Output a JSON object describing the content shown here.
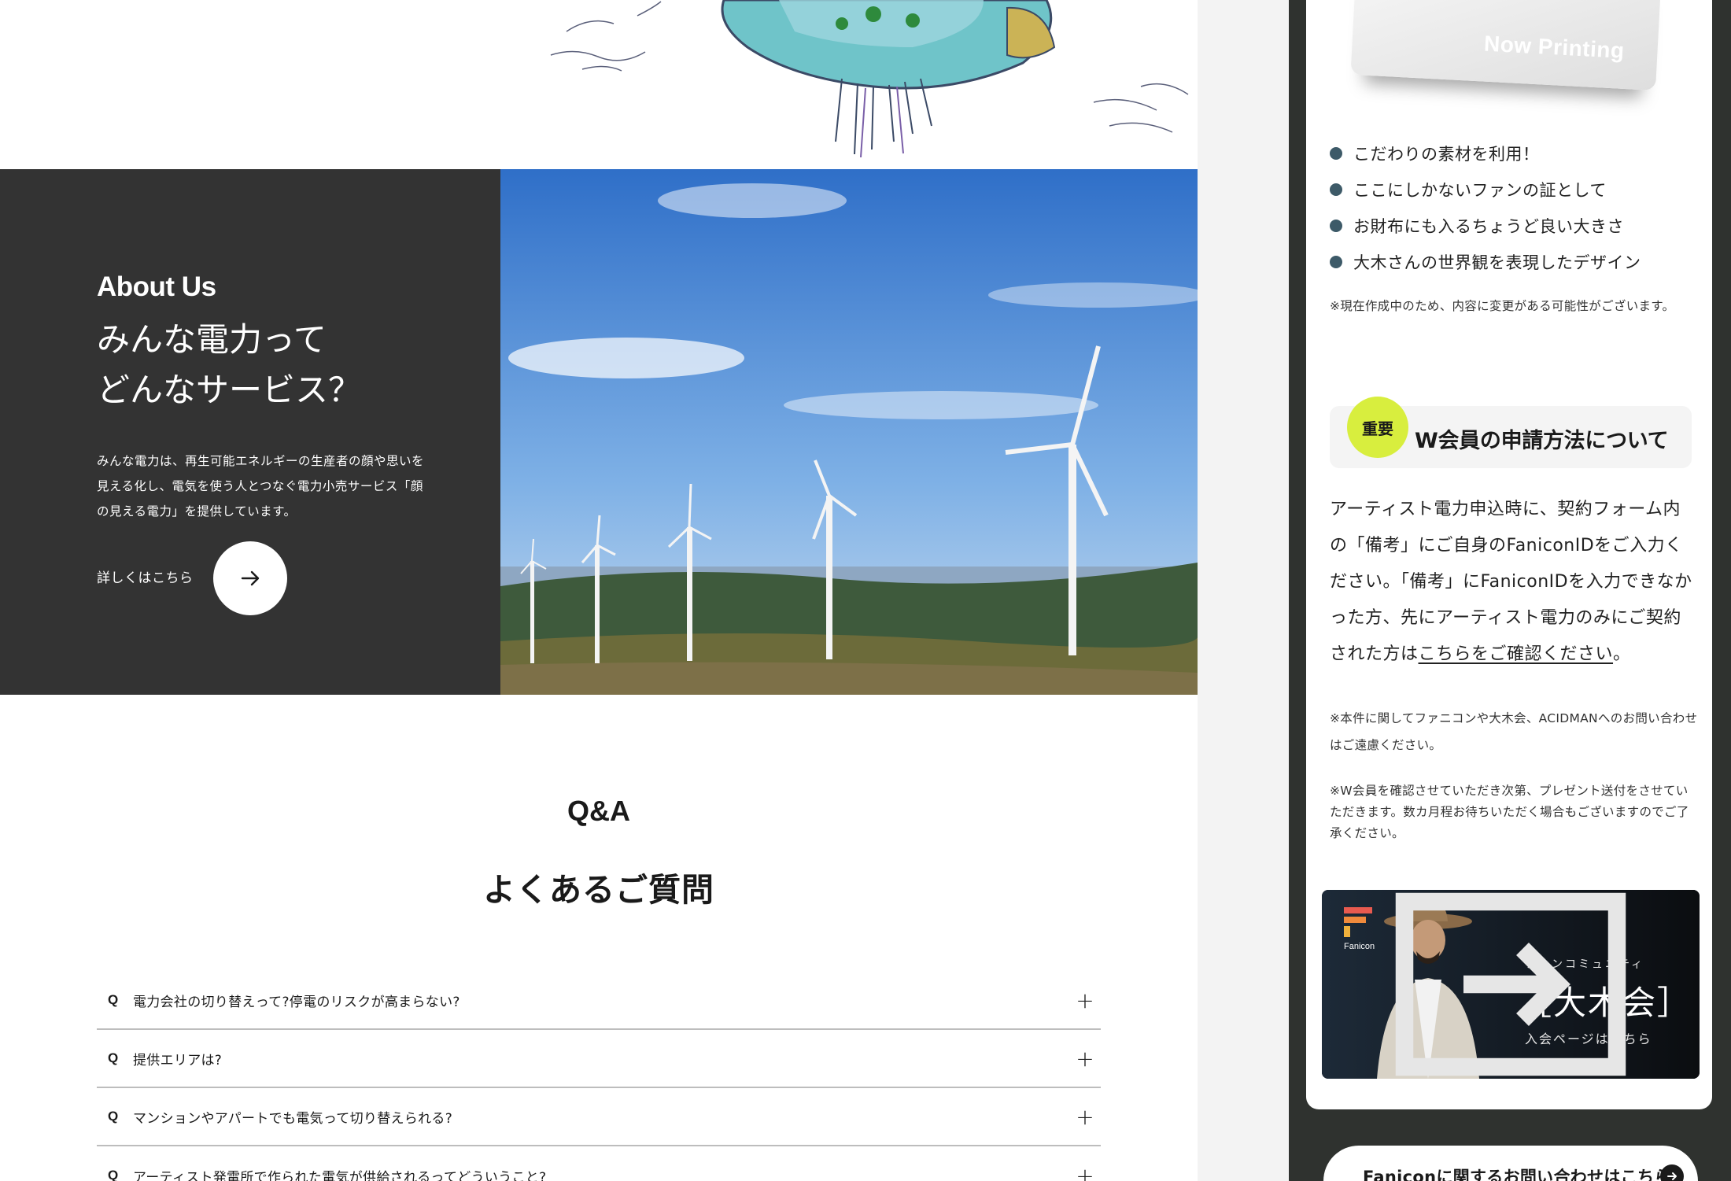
{
  "about": {
    "en_label": "About Us",
    "title_line1": "みんな電力って",
    "title_line2": "どんなサービス？",
    "description": "みんな電力は、再生可能エネルギーの生産者の顔や思いを見える化し、電気を使う人とつなぐ電力小売サービス「顔の見える電力」を提供しています。",
    "more_label": "詳しくはこちら"
  },
  "qa": {
    "en_label": "Q&A",
    "title": "よくあるご質問",
    "items": [
      {
        "q": "Q",
        "text": "電力会社の切り替えって?停電のリスクが高まらない?"
      },
      {
        "q": "Q",
        "text": "提供エリアは?"
      },
      {
        "q": "Q",
        "text": "マンションやアパートでも電気って切り替えられる?"
      },
      {
        "q": "Q",
        "text": "アーティスト発電所で作られた電気が供給されるってどういうこと?"
      }
    ],
    "expand_symbol": "+"
  },
  "sidebar": {
    "card_placeholder": "Now Printing",
    "features": [
      "こだわりの素材を利用！",
      "ここにしかないファンの証として",
      "お財布にも入るちょうど良い大きさ",
      "大木さんの世界観を表現したデザイン"
    ],
    "note_in_progress": "※現在作成中のため、内容に変更がある可能性がございます。",
    "important_badge": "重要",
    "important_title": "W会員の申請方法について",
    "apply_text": "アーティスト電力申込時に、契約フォーム内の「備考」にご自身のFaniconIDをご入力ください。「備考」にFaniconIDを入力できなかった方、先にアーティスト電力のみにご契約された方は",
    "apply_link": "こちらをご確認ください",
    "apply_end": "。",
    "note_inquiry": "※本件に関してファニコンや大木会、ACIDMANへのお問い合わせはご遠慮ください。",
    "note_present": "※W会員を確認させていただき次第、プレゼント送付をさせていただきます。数カ月程お待ちいただく場合もございますのでご了承ください。",
    "banner": {
      "brand": "Fanicon",
      "subtitle": "ファンコミュニティ",
      "name": "［大木会］",
      "join_label": "入会ページはこちら"
    },
    "contact_label": "Faniconに関するお問い合わせはこちら"
  },
  "colors": {
    "dark_panel": "#333333",
    "sidebar_bg": "#2f322f",
    "accent_badge": "#d8ee3e",
    "bullet": "#3d5a68"
  }
}
